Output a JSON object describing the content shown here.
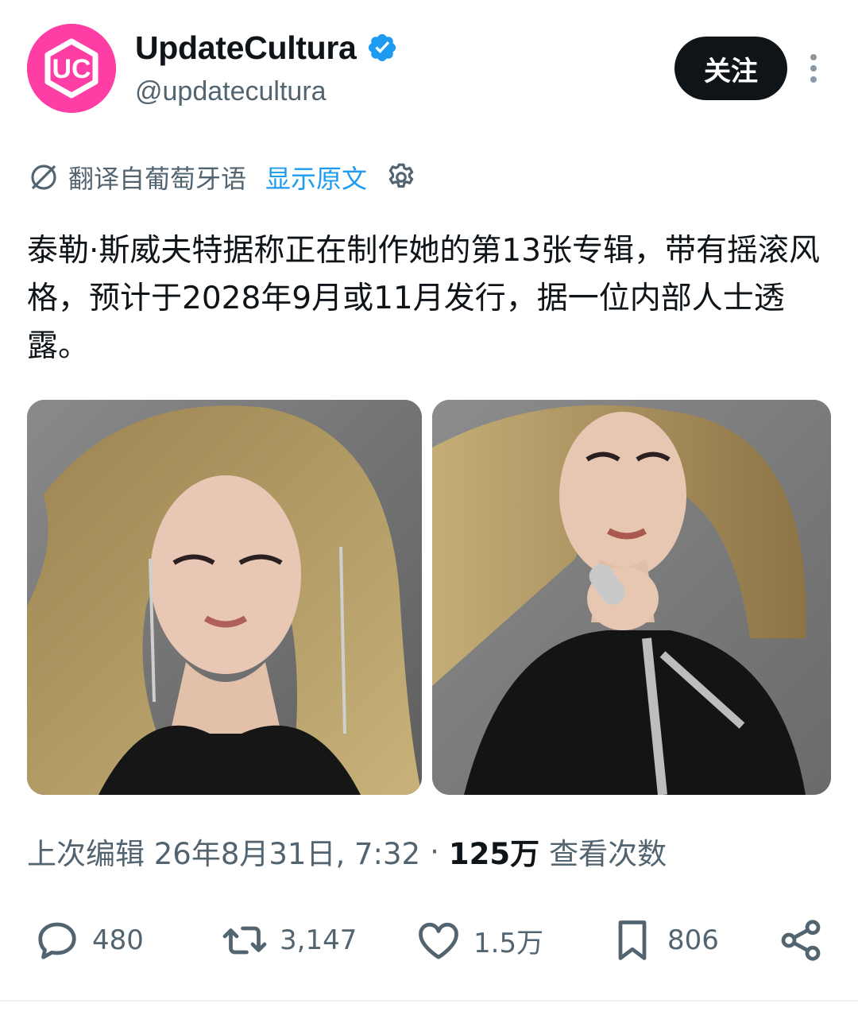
{
  "header": {
    "avatar_text": "UC",
    "display_name": "UpdateCultura",
    "handle": "@updatecultura",
    "follow_label": "关注"
  },
  "translation": {
    "label": "翻译自葡萄牙语",
    "show_original": "显示原文"
  },
  "tweet": {
    "text": "泰勒·斯威夫特据称正在制作她的第13张专辑，带有摇滚风格，预计于2028年9月或11月发行，据一位内部人士透露。"
  },
  "media": {
    "count": 2
  },
  "meta": {
    "edited_label": "上次编辑 26年8月31日, 7:32",
    "separator": "·",
    "views_count": "125万",
    "views_label": "查看次数"
  },
  "actions": {
    "replies": "480",
    "retweets": "3,147",
    "likes": "1.5万",
    "bookmarks": "806"
  },
  "colors": {
    "avatar_bg": "#ff3ea5",
    "verified_blue": "#1d9bf0",
    "link_blue": "#1d9bf0",
    "secondary_text": "#536471",
    "primary_text": "#0f1419"
  }
}
